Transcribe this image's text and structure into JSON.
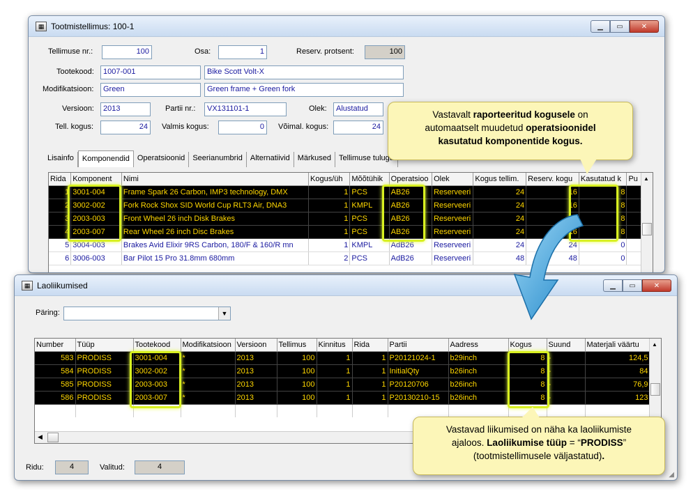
{
  "top_window": {
    "title": "Tootmistellimus: 100-1",
    "fields": {
      "tellimuse_nr_label": "Tellimuse nr.:",
      "tellimuse_nr": "100",
      "osa_label": "Osa:",
      "osa": "1",
      "reserv_label": "Reserv. protsent:",
      "reserv": "100",
      "tootekood_label": "Tootekood:",
      "tootekood": "1007-001",
      "tootekood_desc": "Bike Scott Volt-X",
      "modifikatsioon_label": "Modifikatsioon:",
      "modifikatsioon": "Green",
      "modifikatsioon_desc": "Green frame + Green fork",
      "versioon_label": "Versioon:",
      "versioon": "2013",
      "partii_label": "Partii nr.:",
      "partii": "VX131101-1",
      "olek_label": "Olek:",
      "olek": "Alustatud",
      "tell_kogus_label": "Tell. kogus:",
      "tell_kogus": "24",
      "valmis_label": "Valmis kogus:",
      "valmis": "0",
      "voimal_label": "Võimal. kogus:",
      "voimal": "24"
    },
    "tabs": [
      "Lisainfo",
      "Komponendid",
      "Operatsioonid",
      "Seerianumbrid",
      "Alternatiivid",
      "Märkused",
      "Tellimuse tulugu"
    ],
    "active_tab": "Komponendid",
    "grid": {
      "columns": [
        "Rida",
        "Komponent",
        "Nimi",
        "Kogus/üh",
        "Mõõtühik",
        "Operatsioo",
        "Olek",
        "Kogus tellim.",
        "Reserv. kogu",
        "Kasutatud k",
        "Pu"
      ],
      "rows": [
        {
          "rida": "1",
          "komponent": "3001-004",
          "nimi": "Frame Spark 26 Carbon, IMP3 technology, DMX",
          "kogus": "1",
          "uhik": "PCS",
          "oper": "AB26",
          "olek": "Reserveeri",
          "tellim": "24",
          "reserv": "16",
          "kasutatud": "8",
          "sel": true
        },
        {
          "rida": "2",
          "komponent": "3002-002",
          "nimi": "Fork Rock Shox SID World Cup RLT3 Air, DNA3",
          "kogus": "1",
          "uhik": "KMPL",
          "oper": "AB26",
          "olek": "Reserveeri",
          "tellim": "24",
          "reserv": "16",
          "kasutatud": "8",
          "sel": true
        },
        {
          "rida": "3",
          "komponent": "2003-003",
          "nimi": "Front Wheel 26 inch Disk Brakes",
          "kogus": "1",
          "uhik": "PCS",
          "oper": "AB26",
          "olek": "Reserveeri",
          "tellim": "24",
          "reserv": "",
          "kasutatud": "8",
          "sel": true
        },
        {
          "rida": "4",
          "komponent": "2003-007",
          "nimi": "Rear Wheel 26 inch Disc Brakes",
          "kogus": "1",
          "uhik": "PCS",
          "oper": "AB26",
          "olek": "Reserveeri",
          "tellim": "24",
          "reserv": "16",
          "kasutatud": "8",
          "sel": true
        },
        {
          "rida": "5",
          "komponent": "3004-003",
          "nimi": "Brakes Avid Elixir 9RS Carbon, 180/F & 160/R mn",
          "kogus": "1",
          "uhik": "KMPL",
          "oper": "AdB26",
          "olek": "Reserveeri",
          "tellim": "24",
          "reserv": "24",
          "kasutatud": "0",
          "sel": false
        },
        {
          "rida": "6",
          "komponent": "3006-003",
          "nimi": "Bar Pilot 15 Pro 31.8mm 680mm",
          "kogus": "2",
          "uhik": "PCS",
          "oper": "AdB26",
          "olek": "Reserveeri",
          "tellim": "48",
          "reserv": "48",
          "kasutatud": "0",
          "sel": false
        }
      ]
    }
  },
  "callout_top": {
    "l1_pre": "Vastavalt ",
    "l1_bold": "raporteeritud kogusele",
    "l1_post": " on",
    "l2_pre": "automaatselt muudetud ",
    "l2_bold": "operatsioonidel",
    "l3_bold": "kasutatud komponentide kogus."
  },
  "bottom_window": {
    "title": "Laoliikumised",
    "paring_label": "Päring:",
    "paring_value": "",
    "grid": {
      "columns": [
        "Number",
        "Tüüp",
        "Tootekood",
        "Modifikatsioon",
        "Versioon",
        "Tellimus",
        "Kinnitus",
        "Rida",
        "Partii",
        "Aadress",
        "Kogus",
        "Suund",
        "Materjali väärtu"
      ],
      "rows": [
        {
          "number": "583",
          "tyyp": "PRODISS",
          "tootekood": "3001-004",
          "mod": "*",
          "versioon": "2013",
          "tellimus": "100",
          "kinnitus": "1",
          "rida": "1",
          "partii": "P20121024-1",
          "aadress": "b29inch",
          "kogus": "8",
          "suund": "-",
          "vaartus": "124,5"
        },
        {
          "number": "584",
          "tyyp": "PRODISS",
          "tootekood": "3002-002",
          "mod": "*",
          "versioon": "2013",
          "tellimus": "100",
          "kinnitus": "1",
          "rida": "1",
          "partii": "InitialQty",
          "aadress": "b26inch",
          "kogus": "8",
          "suund": "-",
          "vaartus": "84"
        },
        {
          "number": "585",
          "tyyp": "PRODISS",
          "tootekood": "2003-003",
          "mod": "*",
          "versioon": "2013",
          "tellimus": "100",
          "kinnitus": "1",
          "rida": "1",
          "partii": "P20120706",
          "aadress": "b26inch",
          "kogus": "8",
          "suund": "-",
          "vaartus": "76,9"
        },
        {
          "number": "586",
          "tyyp": "PRODISS",
          "tootekood": "2003-007",
          "mod": "*",
          "versioon": "2013",
          "tellimus": "100",
          "kinnitus": "1",
          "rida": "1",
          "partii": "P20130210-15",
          "aadress": "b26inch",
          "kogus": "8",
          "suund": "-",
          "vaartus": "123"
        }
      ]
    },
    "status": {
      "ridu_label": "Ridu:",
      "ridu": "4",
      "valitud_label": "Valitud:",
      "valitud": "4"
    }
  },
  "callout_bottom": {
    "l1": "Vastavad liikumised on näha ka laoliikumiste",
    "l2_pre": "ajaloos. ",
    "l2_bold": "Laoliikumise tüüp",
    "l2_mid": " = “",
    "l2_bold2": "PRODISS",
    "l2_post": "”",
    "l3": "(tootmistellimusele väljastatud)",
    "l3_end": "."
  },
  "colors": {
    "highlight": "#d8f020",
    "selected_bg": "#000000",
    "selected_text": "#ffd700",
    "callout_bg": "#fcf6b8",
    "arrow": "#2a9ad8"
  }
}
